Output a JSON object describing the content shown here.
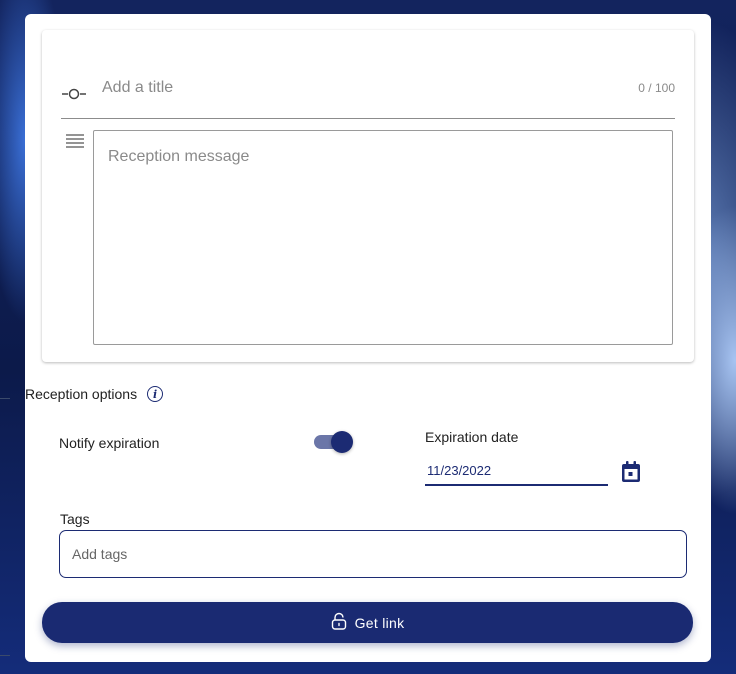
{
  "colors": {
    "accent": "#1c2b73",
    "button_bg": "#1a2a72",
    "toggle_track": "#6b76a8",
    "placeholder": "#8a8a8a"
  },
  "title_field": {
    "placeholder": "Add a title",
    "counter": "0 / 100",
    "icon": "commit-icon"
  },
  "message_field": {
    "placeholder": "Reception message",
    "icon": "text-lines-icon"
  },
  "reception_options": {
    "label": "Reception options",
    "info_icon": "info-icon",
    "info_glyph": "i",
    "notify_expiration": {
      "label": "Notify expiration",
      "enabled": true
    },
    "expiration_date": {
      "label": "Expiration date",
      "value": "11/23/2022",
      "icon": "calendar-icon"
    }
  },
  "tags": {
    "label": "Tags",
    "placeholder": "Add tags"
  },
  "get_link_button": {
    "label": "Get link",
    "icon": "lock-icon"
  }
}
